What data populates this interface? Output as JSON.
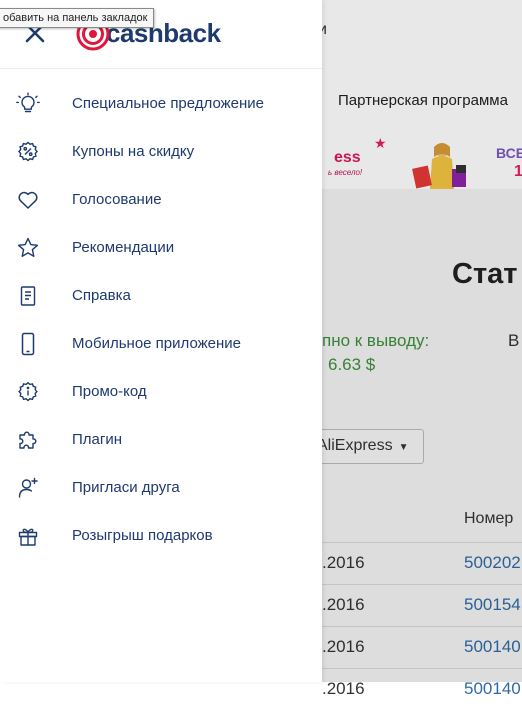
{
  "tooltip": {
    "text": "обавить на панель закладок"
  },
  "logo": {
    "text": "cashback"
  },
  "menu": {
    "items": [
      {
        "icon": "lightbulb-icon",
        "label": "Специальное предложение"
      },
      {
        "icon": "coupon-percent-icon",
        "label": "Купоны на скидку"
      },
      {
        "icon": "heart-icon",
        "label": "Голосование"
      },
      {
        "icon": "star-icon",
        "label": "Рекомендации"
      },
      {
        "icon": "document-icon",
        "label": "Справка"
      },
      {
        "icon": "smartphone-icon",
        "label": "Мобильное приложение"
      },
      {
        "icon": "info-icon",
        "label": "Промо-код"
      },
      {
        "icon": "puzzle-icon",
        "label": "Плагин"
      },
      {
        "icon": "invite-user-icon",
        "label": "Пригласи друга"
      },
      {
        "icon": "gift-icon",
        "label": "Розыгрыш подарков"
      }
    ]
  },
  "background": {
    "header_fragment": "и",
    "nav_link": "Партнерская программа",
    "banner": {
      "left_text": "ess",
      "left_sub": "ь весело!",
      "right_text": "ВСЕ",
      "right_num": "1"
    },
    "stats_title": "Стат",
    "withdraw_label": "пно к выводу:",
    "withdraw_value": "6.63 $",
    "b_letter": "В",
    "store_select": "AliExpress",
    "col_number": "Номер",
    "rows": [
      {
        "date": ".2016",
        "id": "500202"
      },
      {
        "date": ".2016",
        "id": "500154"
      },
      {
        "date": ".2016",
        "id": "500140"
      },
      {
        "date": ".2016",
        "id": "500140"
      }
    ]
  },
  "colors": {
    "brand_navy": "#1e3a6e",
    "brand_red": "#e0173c",
    "link_blue": "#2f6aa6",
    "balance_green": "#3c8f3c"
  }
}
